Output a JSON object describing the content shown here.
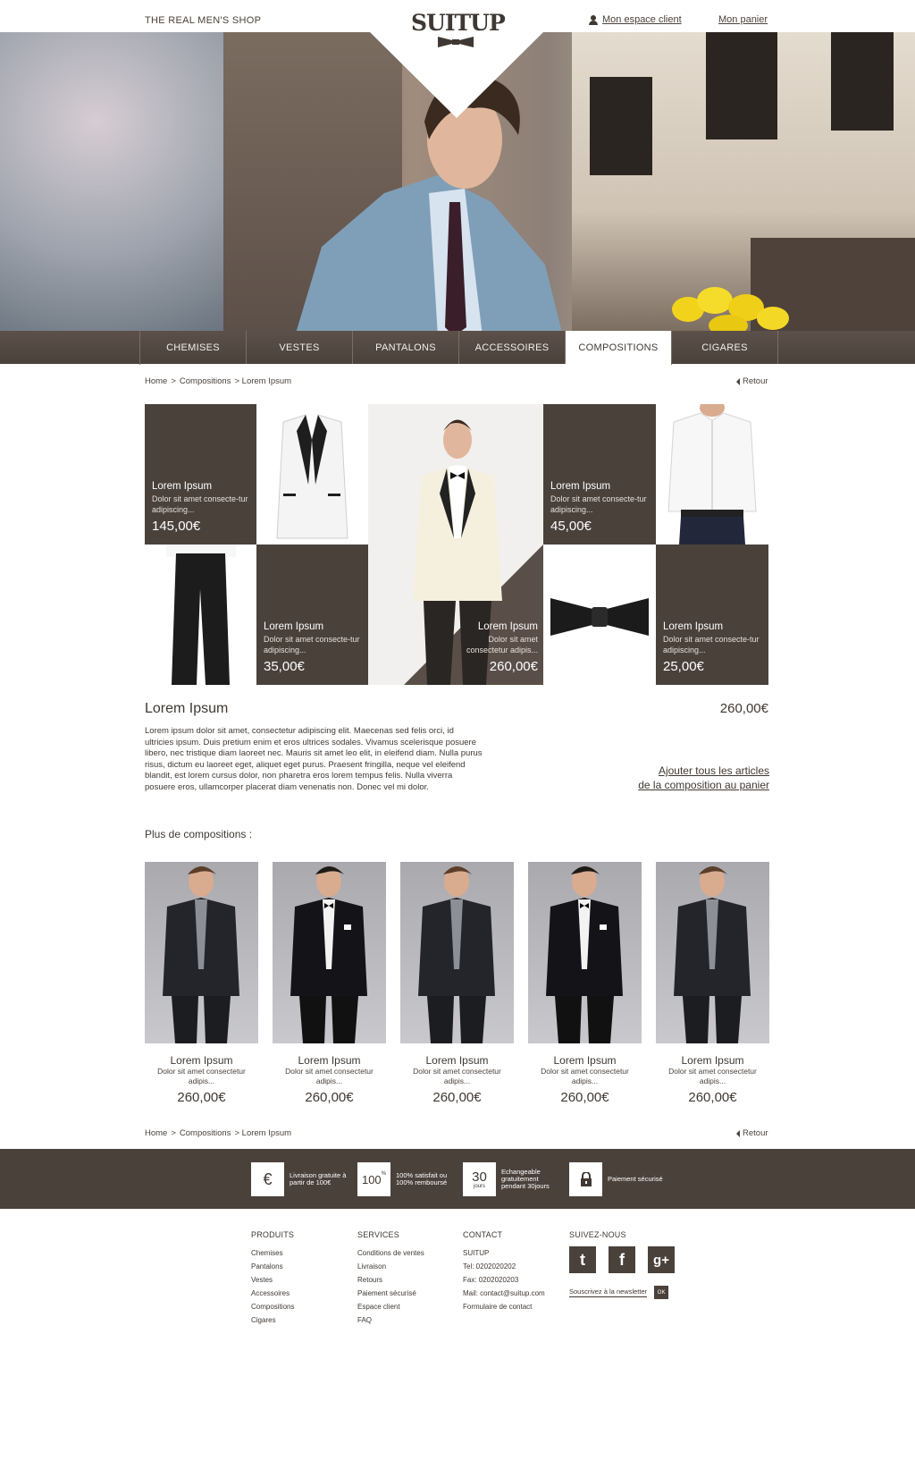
{
  "header": {
    "tagline": "THE REAL MEN'S SHOP",
    "logo": "SUITUP",
    "account": "Mon espace client",
    "cart": "Mon panier"
  },
  "nav": {
    "items": [
      {
        "label": "CHEMISES"
      },
      {
        "label": "VESTES"
      },
      {
        "label": "PANTALONS"
      },
      {
        "label": "ACCESSOIRES"
      },
      {
        "label": "COMPOSITIONS",
        "active": true
      },
      {
        "label": "CIGARES"
      }
    ]
  },
  "breadcrumb": {
    "home": "Home",
    "sep1": ">",
    "section": "Compositions",
    "sep2": "> Lorem Ipsum",
    "back": "Retour"
  },
  "composition": {
    "cards": [
      {
        "title": "Lorem Ipsum",
        "desc": "Dolor sit  amet consecte-tur adipiscing...",
        "price": "145,00€"
      },
      {
        "title": "Lorem Ipsum",
        "desc": "Dolor sit  amet consecte-tur adipiscing...",
        "price": "45,00€"
      },
      {
        "title": "Lorem Ipsum",
        "desc": "Dolor sit  amet consecte-tur adipiscing...",
        "price": "35,00€"
      },
      {
        "title": "Lorem Ipsum",
        "desc": "Dolor sit  amet consectetur adipis...",
        "price": "260,00€"
      },
      {
        "title": "Lorem Ipsum",
        "desc": "Dolor sit  amet consecte-tur adipiscing...",
        "price": "25,00€"
      }
    ],
    "title": "Lorem Ipsum",
    "price": "260,00€",
    "description": "Lorem ipsum dolor sit amet, consectetur adipiscing elit. Maecenas sed felis orci, id ultricies ipsum. Duis pretium enim et eros ultrices sodales. Vivamus scelerisque posuere libero, nec tristique diam laoreet nec. Mauris sit amet leo elit, in eleifend diam. Nulla purus risus, dictum eu laoreet eget, aliquet eget purus. Praesent fringilla, neque vel eleifend blandit, est lorem cursus dolor, non pharetra eros lorem tempus felis. Nulla viverra posuere eros, ullamcorper placerat diam venenatis non. Donec vel mi dolor.",
    "add_all_line1": "Ajouter tous les articles",
    "add_all_line2": "de la composition au panier"
  },
  "more": {
    "title": "Plus de compositions :",
    "items": [
      {
        "name": "Lorem Ipsum",
        "desc": "Dolor sit  amet consectetur adipis...",
        "price": "260,00€"
      },
      {
        "name": "Lorem Ipsum",
        "desc": "Dolor sit  amet consectetur adipis...",
        "price": "260,00€"
      },
      {
        "name": "Lorem Ipsum",
        "desc": "Dolor sit  amet consectetur adipis...",
        "price": "260,00€"
      },
      {
        "name": "Lorem Ipsum",
        "desc": "Dolor sit  amet consectetur adipis...",
        "price": "260,00€"
      },
      {
        "name": "Lorem Ipsum",
        "desc": "Dolor sit  amet consectetur adipis...",
        "price": "260,00€"
      }
    ]
  },
  "features": [
    {
      "icon": "euro-icon",
      "symbol": "€",
      "text": "Livraison gratuite à partir de 100€"
    },
    {
      "icon": "percent-badge",
      "symbol": "100",
      "sup": "%",
      "text": "100% satisfait ou 100% remboursé"
    },
    {
      "icon": "calendar-badge",
      "symbol": "30",
      "sub": "jours",
      "text": "Echangeable gratuitement pendant 30jours"
    },
    {
      "icon": "lock-icon",
      "symbol": "",
      "text": "Paiement sécurisé"
    }
  ],
  "footer": {
    "produits": {
      "title": "PRODUITS",
      "links": [
        "Chemises",
        "Pantalons",
        "Vestes",
        "Accessoires",
        "Compositions",
        "Cigares"
      ]
    },
    "services": {
      "title": "SERVICES",
      "links": [
        "Conditions de ventes",
        "Livraison",
        "Retours",
        "Paiement sécurisé",
        "Espace client",
        "FAQ"
      ]
    },
    "contact": {
      "title": "CONTACT",
      "lines": [
        "SUITUP",
        "Tel: 0202020202",
        "Fax: 0202020203",
        "Mail: contact@suitup.com",
        "Formulaire de contact"
      ]
    },
    "social": {
      "title": "SUIVEZ-NOUS",
      "twitter": "t",
      "facebook": "f",
      "googleplus": "g+",
      "newsletter": "Souscrivez à la newsletter",
      "ok": "OK"
    }
  },
  "colors": {
    "brand_dark": "#4a413b",
    "text": "#3f3833",
    "background": "#ffffff"
  }
}
